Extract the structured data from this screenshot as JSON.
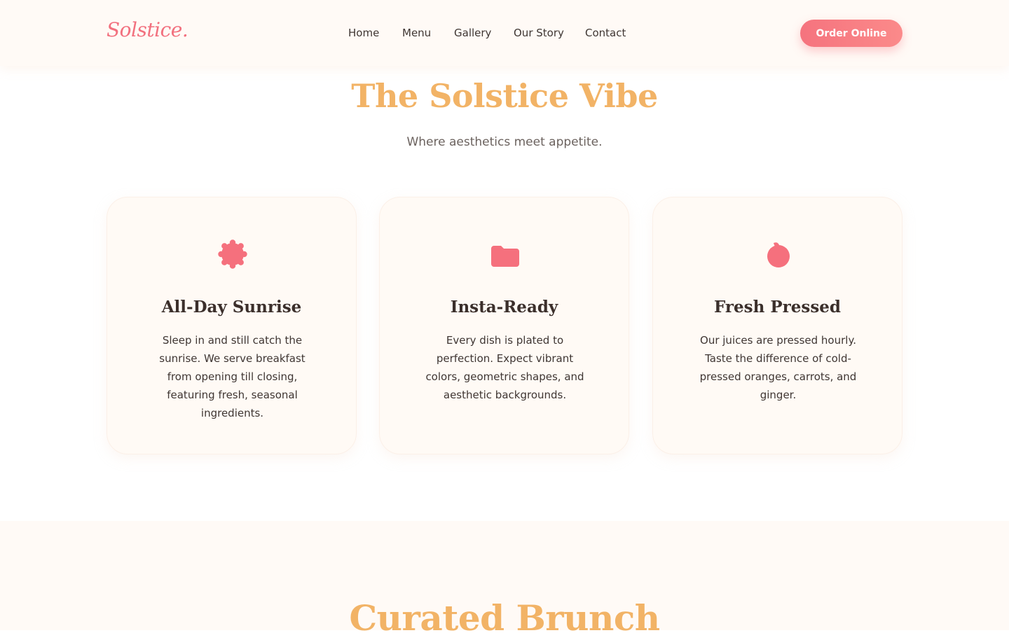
{
  "header": {
    "logo": "Solstice.",
    "nav": [
      {
        "label": "Home"
      },
      {
        "label": "Menu"
      },
      {
        "label": "Gallery"
      },
      {
        "label": "Our Story"
      },
      {
        "label": "Contact"
      }
    ],
    "cta_label": "Order Online"
  },
  "vibe": {
    "title": "The Solstice Vibe",
    "subtitle": "Where aesthetics meet appetite."
  },
  "features": [
    {
      "icon": "sun-badge-icon",
      "title": "All-Day Sunrise",
      "text": "Sleep in and still catch the sunrise. We serve breakfast from opening till closing, featuring fresh, seasonal ingredients."
    },
    {
      "icon": "folder-icon",
      "title": "Insta-Ready",
      "text": "Every dish is plated to perfection. Expect vibrant colors, geometric shapes, and aesthetic backgrounds."
    },
    {
      "icon": "orange-icon",
      "title": "Fresh Pressed",
      "text": "Our juices are pressed hourly. Taste the difference of cold-pressed oranges, carrots, and ginger."
    }
  ],
  "menu_section": {
    "title": "Curated Brunch"
  },
  "colors": {
    "accent_coral": "#f5737e",
    "accent_gold": "#f2b366",
    "cream": "#fffaf6",
    "text_dark": "#3b2f2b"
  }
}
